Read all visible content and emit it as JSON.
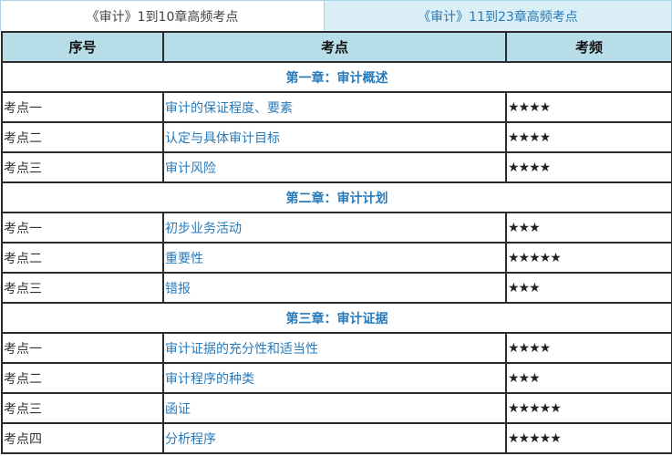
{
  "tabs": [
    "《审计》1到10章高频考点",
    "《审计》11到23章高频考点"
  ],
  "headers": [
    "序号",
    "考点",
    "考频"
  ],
  "chapters": [
    {
      "title": "第一章：审计概述",
      "rows": [
        {
          "no": "考点一",
          "topic": "审计的保证程度、要素",
          "freq": "★★★★"
        },
        {
          "no": "考点二",
          "topic": "认定与具体审计目标",
          "freq": "★★★★"
        },
        {
          "no": "考点三",
          "topic": "审计风险",
          "freq": "★★★★"
        }
      ]
    },
    {
      "title": "第二章：审计计划",
      "rows": [
        {
          "no": "考点一",
          "topic": "初步业务活动",
          "freq": "★★★"
        },
        {
          "no": "考点二",
          "topic": "重要性",
          "freq": "★★★★★"
        },
        {
          "no": "考点三",
          "topic": "错报",
          "freq": "★★★"
        }
      ]
    },
    {
      "title": "第三章：审计证据",
      "rows": [
        {
          "no": "考点一",
          "topic": "审计证据的充分性和适当性",
          "freq": "★★★★"
        },
        {
          "no": "考点二",
          "topic": "审计程序的种类",
          "freq": "★★★"
        },
        {
          "no": "考点三",
          "topic": "函证",
          "freq": "★★★★★"
        },
        {
          "no": "考点四",
          "topic": "分析程序",
          "freq": "★★★★★"
        }
      ]
    }
  ]
}
